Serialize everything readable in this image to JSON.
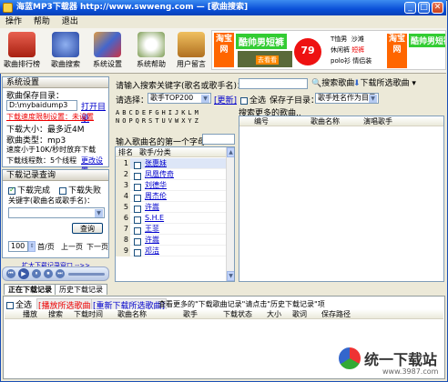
{
  "window": {
    "title": "海蓝MP3下载器  http://www.swweng.com — [歌曲搜索]",
    "min": "_",
    "max": "□",
    "close": "✕"
  },
  "menu": [
    "操作",
    "帮助",
    "退出"
  ],
  "toolbar": [
    {
      "label": "歌曲排行榜",
      "icon": "radio-icon",
      "color": "#c83a2c"
    },
    {
      "label": "歌曲搜索",
      "icon": "music-search-icon",
      "color": "#3c6bd0"
    },
    {
      "label": "系统设置",
      "icon": "settings-icon",
      "color": "#6a5acd"
    },
    {
      "label": "系统帮助",
      "icon": "help-icon",
      "color": "#4a7a3c"
    },
    {
      "label": "用户留言",
      "icon": "message-icon",
      "color": "#d49a2e"
    }
  ],
  "ad": {
    "brand": "淘宝网",
    "headline": "酷帅男短裤",
    "price": "79",
    "price_unit": "元",
    "items": [
      "T恤男",
      "沙滩",
      "休闲裤",
      "短裤",
      "polo衫",
      "情侣装"
    ],
    "extra": "酷帅男短裤",
    "cta": "去看看"
  },
  "settings": {
    "title": "系统设置",
    "save_dir_label": "歌曲保存目录：",
    "save_dir": "D:\\mybaidump3",
    "open_dir": "打开目录",
    "current_status": "下载速度限制设置：未设置",
    "max_size": "下载大小：最多近4M",
    "type": "歌曲类型：mp3",
    "speed_rule": "速度小于10K/秒时放弃下载",
    "threads_label": "下载线程数：5个线程",
    "change_link": "更改设置"
  },
  "history": {
    "title": "下载记录查询",
    "done": "下载完成",
    "failed": "下载失败",
    "keyword_label": "关键字(歌曲名或歌手名)：",
    "query_btn": "查询",
    "page_size": "100",
    "first": "首/页",
    "prev": "上一页",
    "next": "下一页",
    "more": "扩大下载记录窗口 -->>"
  },
  "player": {
    "controls": [
      "⏮",
      "▶",
      "⏸",
      "⏹",
      "⏭"
    ]
  },
  "search": {
    "keyword_label": "请输入搜索关键字(歌名或歌手名)：",
    "search_btn": "搜索歌曲",
    "dir_btn": "下载所选歌曲",
    "choose_label": "请选择：",
    "choose_value": "歌手TOP200",
    "refresh": "[更新]",
    "select_all": "全选",
    "save_dir_label": "保存子目录：",
    "save_dir_value": "歌手姓名作为目录",
    "letters": [
      "A",
      "B",
      "C",
      "D",
      "E",
      "F",
      "G",
      "H",
      "I",
      "J",
      "K",
      "L",
      "M",
      "N",
      "O",
      "P",
      "Q",
      "R",
      "S",
      "T",
      "U",
      "V",
      "W",
      "X",
      "Y",
      "Z"
    ],
    "first_char_label": "输入歌曲名的第一个字母：",
    "result_label": "搜索更多的歌曲..",
    "list_headers": [
      "排名",
      "歌手/分类"
    ],
    "singers": [
      "张惠妹",
      "凤凰传奇",
      "刘德华",
      "周杰伦",
      "许嵩",
      "S.H.E",
      "王菲",
      "许嵩",
      "邓洁"
    ],
    "result_headers": [
      "编号",
      "歌曲名称",
      "演唱歌手"
    ]
  },
  "downloads": {
    "tabs": [
      "正在下载记录",
      "历史下载记录"
    ],
    "select_all": "全选",
    "play_btn": "[播放所选歌曲]",
    "retry_btn": "[重新下载所选歌曲]",
    "hint": "查看更多的\"下载歌曲记录\"请点击\"历史下载记录\"项",
    "headers": [
      "播放",
      "搜索",
      "下载时间",
      "歌曲名称",
      "歌手",
      "下载状态",
      "大小",
      "歌词",
      "保存路径"
    ]
  },
  "watermark": {
    "brand": "统一下载站",
    "url": "www.3987.com"
  }
}
